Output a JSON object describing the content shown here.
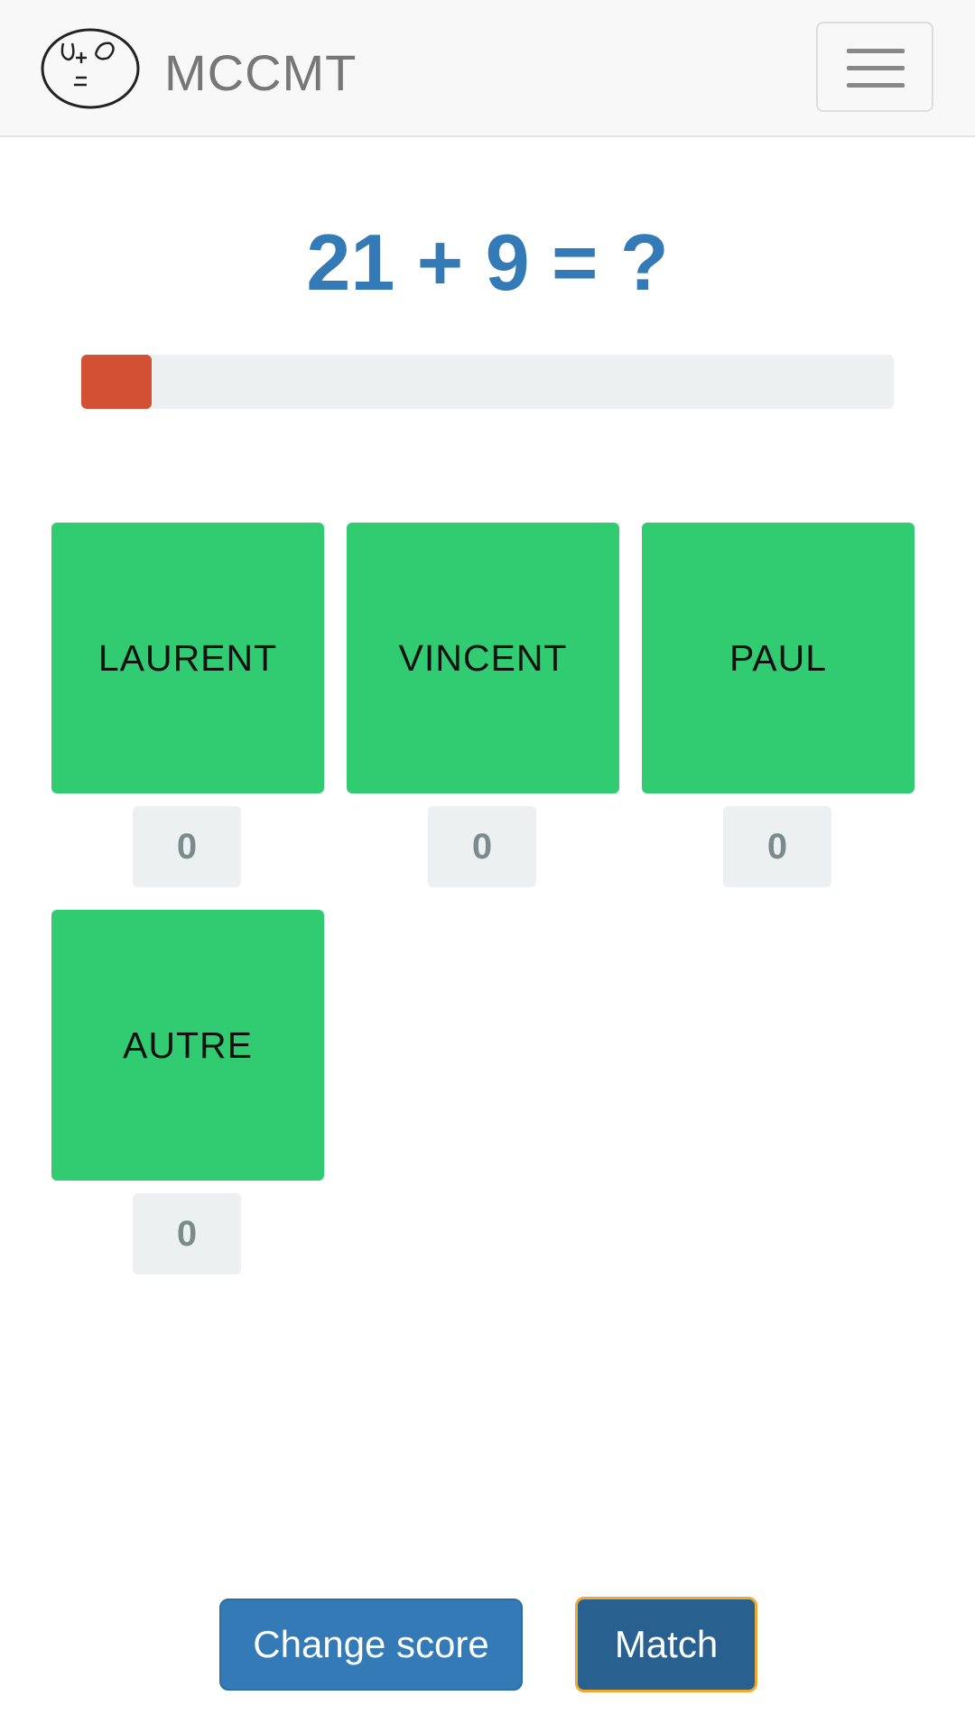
{
  "navbar": {
    "brand": "MCCMT",
    "logo_icon": "face-logo-icon",
    "menu_icon": "hamburger-menu-icon"
  },
  "question": {
    "text": "21 + 9 = ?"
  },
  "timer": {
    "progress_fraction": 0.087,
    "color": "#d35035",
    "track_color": "#ecf0f1"
  },
  "players": [
    {
      "name": "LAURENT",
      "score": "0"
    },
    {
      "name": "VINCENT",
      "score": "0"
    },
    {
      "name": "PAUL",
      "score": "0"
    },
    {
      "name": "AUTRE",
      "score": "0"
    }
  ],
  "colors": {
    "tile": "#31cc71",
    "primary": "#337ab7",
    "primary_active": "#286090",
    "focus_outline": "#f0a830"
  },
  "actions": {
    "change_score_label": "Change score",
    "match_label": "Match"
  }
}
